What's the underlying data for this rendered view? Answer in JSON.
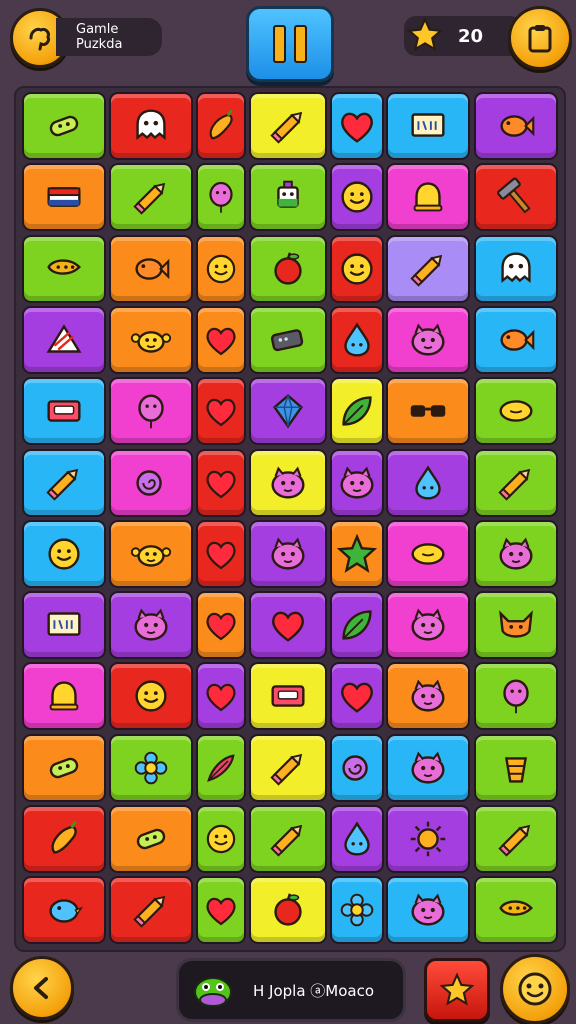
{
  "header": {
    "title_line1": "Gamle",
    "title_line2": "Puzkda",
    "score": "20",
    "menu_icon": "brain-icon",
    "pause_icon": "pause-icon",
    "star_icon": "star-icon",
    "clipboard_icon": "clipboard-icon"
  },
  "footer": {
    "back_icon": "back-arrow-icon",
    "bonus_label": "H Jopla ⓐMoaco",
    "bonus_icon": "monster-icon",
    "star_icon": "star-icon",
    "face_icon": "face-icon"
  },
  "colors": {
    "green": "#7ed321",
    "red": "#e8271f",
    "yellow": "#f2ef2a",
    "blue": "#29b6f6",
    "purple": "#a43ee0",
    "orange": "#fb8c1c",
    "pink": "#f13fcf",
    "lavender": "#a98cf5"
  },
  "board": {
    "rows": [
      [
        {
          "color": "green",
          "icon": "candy-icon"
        },
        {
          "color": "red",
          "icon": "ghost-icon"
        },
        {
          "color": "red",
          "icon": "pepper-icon"
        },
        {
          "color": "yellow",
          "icon": "pencil-icon"
        },
        {
          "color": "blue",
          "icon": "heart-icon"
        },
        {
          "color": "blue",
          "icon": "sign-icon"
        },
        {
          "color": "purple",
          "icon": "fish-icon"
        }
      ],
      [
        {
          "color": "orange",
          "icon": "eraser-icon"
        },
        {
          "color": "green",
          "icon": "pencil-icon"
        },
        {
          "color": "green",
          "icon": "balloon-icon"
        },
        {
          "color": "green",
          "icon": "robot-icon"
        },
        {
          "color": "purple",
          "icon": "smiley-icon"
        },
        {
          "color": "pink",
          "icon": "bell-icon"
        },
        {
          "color": "red",
          "icon": "hammer-icon"
        }
      ],
      [
        {
          "color": "green",
          "icon": "carrot-icon"
        },
        {
          "color": "orange",
          "icon": "fish-icon"
        },
        {
          "color": "orange",
          "icon": "smiley-icon"
        },
        {
          "color": "green",
          "icon": "apple-icon"
        },
        {
          "color": "red",
          "icon": "smiley-icon"
        },
        {
          "color": "lavender",
          "icon": "pencil-icon"
        },
        {
          "color": "blue",
          "icon": "ghost-icon"
        }
      ],
      [
        {
          "color": "purple",
          "icon": "ruler-icon"
        },
        {
          "color": "orange",
          "icon": "crab-icon"
        },
        {
          "color": "orange",
          "icon": "heart-icon"
        },
        {
          "color": "green",
          "icon": "battery-icon"
        },
        {
          "color": "red",
          "icon": "drop-icon"
        },
        {
          "color": "pink",
          "icon": "monster-icon"
        },
        {
          "color": "blue",
          "icon": "fish-icon"
        }
      ],
      [
        {
          "color": "blue",
          "icon": "cassette-icon"
        },
        {
          "color": "pink",
          "icon": "balloon-icon"
        },
        {
          "color": "red",
          "icon": "heart-icon"
        },
        {
          "color": "purple",
          "icon": "gem-icon"
        },
        {
          "color": "yellow",
          "icon": "leaf-icon"
        },
        {
          "color": "orange",
          "icon": "glasses-icon"
        },
        {
          "color": "green",
          "icon": "lemon-icon"
        }
      ],
      [
        {
          "color": "blue",
          "icon": "pencil-icon"
        },
        {
          "color": "pink",
          "icon": "snail-icon"
        },
        {
          "color": "red",
          "icon": "heart-icon"
        },
        {
          "color": "yellow",
          "icon": "monster-icon"
        },
        {
          "color": "purple",
          "icon": "monster-icon"
        },
        {
          "color": "purple",
          "icon": "drop-icon"
        },
        {
          "color": "green",
          "icon": "pencil-icon"
        }
      ],
      [
        {
          "color": "blue",
          "icon": "smiley-icon"
        },
        {
          "color": "orange",
          "icon": "crab-icon"
        },
        {
          "color": "red",
          "icon": "heart-icon"
        },
        {
          "color": "purple",
          "icon": "monster-icon"
        },
        {
          "color": "orange",
          "icon": "star-icon"
        },
        {
          "color": "pink",
          "icon": "lemon-icon"
        },
        {
          "color": "green",
          "icon": "monster-icon"
        }
      ],
      [
        {
          "color": "purple",
          "icon": "sign-icon"
        },
        {
          "color": "purple",
          "icon": "monster-icon"
        },
        {
          "color": "orange",
          "icon": "heart-icon"
        },
        {
          "color": "purple",
          "icon": "heart-icon"
        },
        {
          "color": "purple",
          "icon": "leaf-icon"
        },
        {
          "color": "pink",
          "icon": "monster-icon"
        },
        {
          "color": "green",
          "icon": "fox-icon"
        }
      ],
      [
        {
          "color": "pink",
          "icon": "bell-icon"
        },
        {
          "color": "red",
          "icon": "smiley-icon"
        },
        {
          "color": "purple",
          "icon": "heart-icon"
        },
        {
          "color": "yellow",
          "icon": "cassette-icon"
        },
        {
          "color": "purple",
          "icon": "heart-icon"
        },
        {
          "color": "orange",
          "icon": "monster-icon"
        },
        {
          "color": "green",
          "icon": "balloon-icon"
        }
      ],
      [
        {
          "color": "orange",
          "icon": "candy-icon"
        },
        {
          "color": "green",
          "icon": "flower-icon"
        },
        {
          "color": "green",
          "icon": "feather-icon"
        },
        {
          "color": "yellow",
          "icon": "pencil-icon"
        },
        {
          "color": "blue",
          "icon": "snail-icon"
        },
        {
          "color": "blue",
          "icon": "monster-icon"
        },
        {
          "color": "green",
          "icon": "cup-icon"
        }
      ],
      [
        {
          "color": "red",
          "icon": "pepper-icon"
        },
        {
          "color": "orange",
          "icon": "candy-icon"
        },
        {
          "color": "green",
          "icon": "smiley-icon"
        },
        {
          "color": "green",
          "icon": "pencil-icon"
        },
        {
          "color": "purple",
          "icon": "drop-icon"
        },
        {
          "color": "purple",
          "icon": "sun-icon"
        },
        {
          "color": "green",
          "icon": "pencil-icon"
        }
      ],
      [
        {
          "color": "red",
          "icon": "bird-icon"
        },
        {
          "color": "red",
          "icon": "pencil-icon"
        },
        {
          "color": "green",
          "icon": "heart-icon"
        },
        {
          "color": "yellow",
          "icon": "apple-icon"
        },
        {
          "color": "blue",
          "icon": "flower-icon"
        },
        {
          "color": "blue",
          "icon": "monster-icon"
        },
        {
          "color": "green",
          "icon": "carrot-icon"
        }
      ]
    ]
  }
}
